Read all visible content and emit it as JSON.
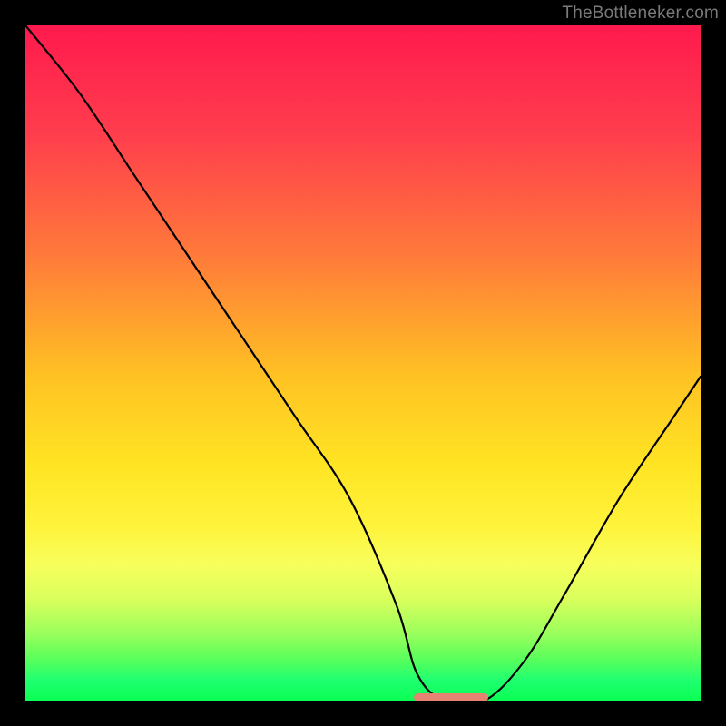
{
  "watermark": "TheBottleneker.com",
  "chart_data": {
    "type": "line",
    "title": "",
    "xlabel": "",
    "ylabel": "",
    "xlim": [
      0,
      100
    ],
    "ylim": [
      0,
      100
    ],
    "series": [
      {
        "name": "bottleneck-curve",
        "x": [
          0,
          8,
          16,
          24,
          32,
          40,
          48,
          55,
          58,
          62,
          68,
          74,
          80,
          88,
          96,
          100
        ],
        "values": [
          100,
          90,
          78,
          66,
          54,
          42,
          30,
          14,
          4,
          0,
          0,
          6,
          16,
          30,
          42,
          48
        ]
      }
    ],
    "optimal_band": {
      "x_start": 58,
      "x_end": 68,
      "y": 0
    },
    "background_gradient": {
      "top": "#ff1a4d",
      "mid": "#ffe423",
      "bottom": "#0aff54"
    }
  }
}
